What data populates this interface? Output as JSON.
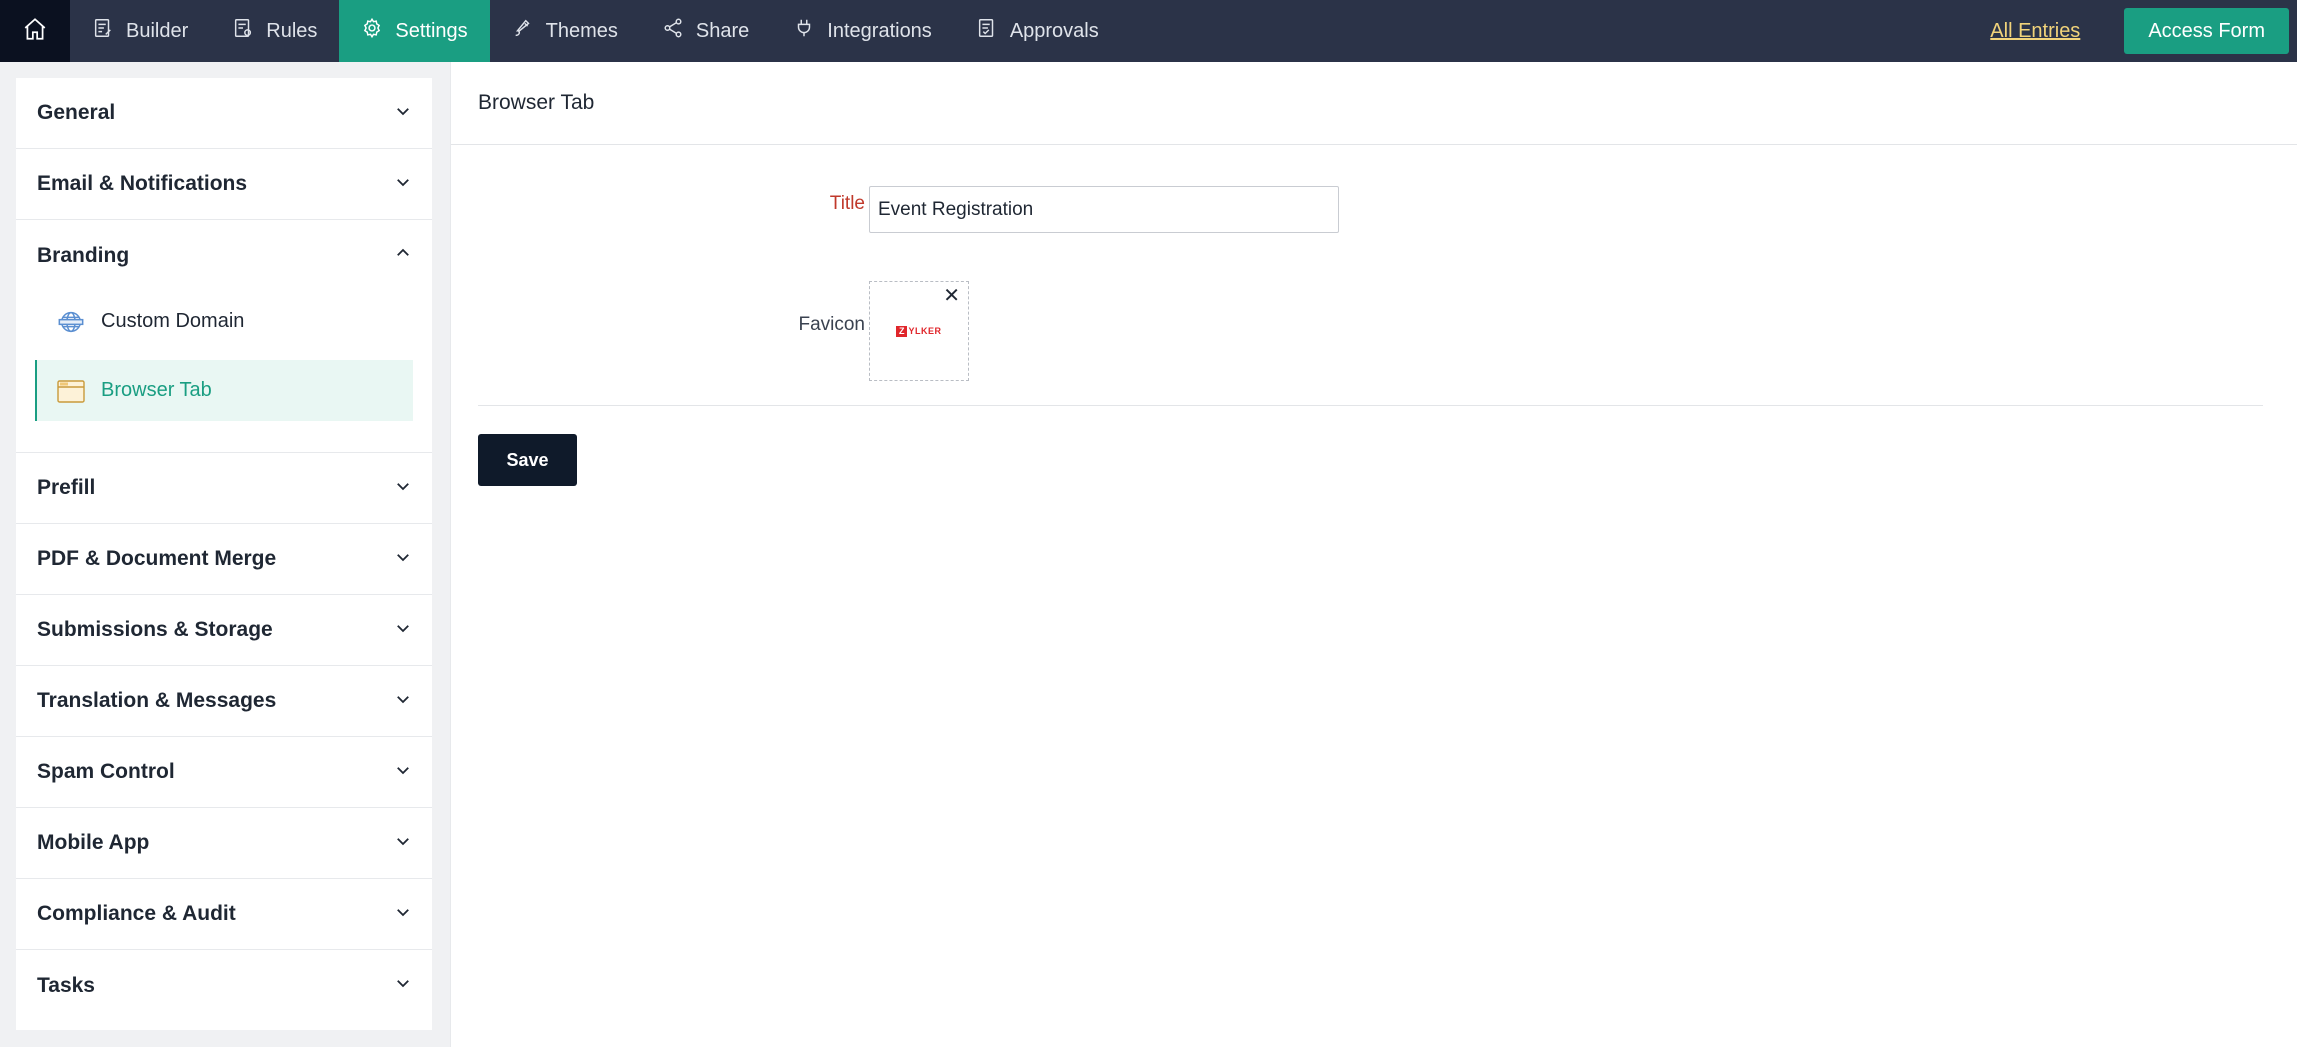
{
  "nav": {
    "home_icon": "home-icon",
    "items": [
      {
        "label": "Builder",
        "icon": "builder-icon"
      },
      {
        "label": "Rules",
        "icon": "rules-icon"
      },
      {
        "label": "Settings",
        "icon": "gear-icon",
        "active": true
      },
      {
        "label": "Themes",
        "icon": "brush-icon"
      },
      {
        "label": "Share",
        "icon": "share-icon"
      },
      {
        "label": "Integrations",
        "icon": "plug-icon"
      },
      {
        "label": "Approvals",
        "icon": "approvals-icon"
      }
    ],
    "all_entries": "All Entries",
    "access_form": "Access Form"
  },
  "sidebar": {
    "sections": [
      {
        "label": "General",
        "expanded": false
      },
      {
        "label": "Email & Notifications",
        "expanded": false
      },
      {
        "label": "Branding",
        "expanded": true,
        "items": [
          {
            "label": "Custom Domain",
            "icon": "globe-icon",
            "active": false
          },
          {
            "label": "Browser Tab",
            "icon": "browser-tab-icon",
            "active": true
          }
        ]
      },
      {
        "label": "Prefill",
        "expanded": false
      },
      {
        "label": "PDF & Document Merge",
        "expanded": false
      },
      {
        "label": "Submissions & Storage",
        "expanded": false
      },
      {
        "label": "Translation & Messages",
        "expanded": false
      },
      {
        "label": "Spam Control",
        "expanded": false
      },
      {
        "label": "Mobile App",
        "expanded": false
      },
      {
        "label": "Compliance & Audit",
        "expanded": false
      },
      {
        "label": "Tasks",
        "expanded": false
      }
    ]
  },
  "main": {
    "header": "Browser Tab",
    "title_label": "Title",
    "title_value": "Event Registration",
    "favicon_label": "Favicon",
    "favicon_logo_text": "ZYLKER",
    "save_label": "Save"
  },
  "colors": {
    "nav_bg": "#2b3348",
    "accent": "#1a9e82",
    "link": "#f1d37a",
    "required_label": "#c0392b",
    "save_bg": "#0f1a2a"
  }
}
